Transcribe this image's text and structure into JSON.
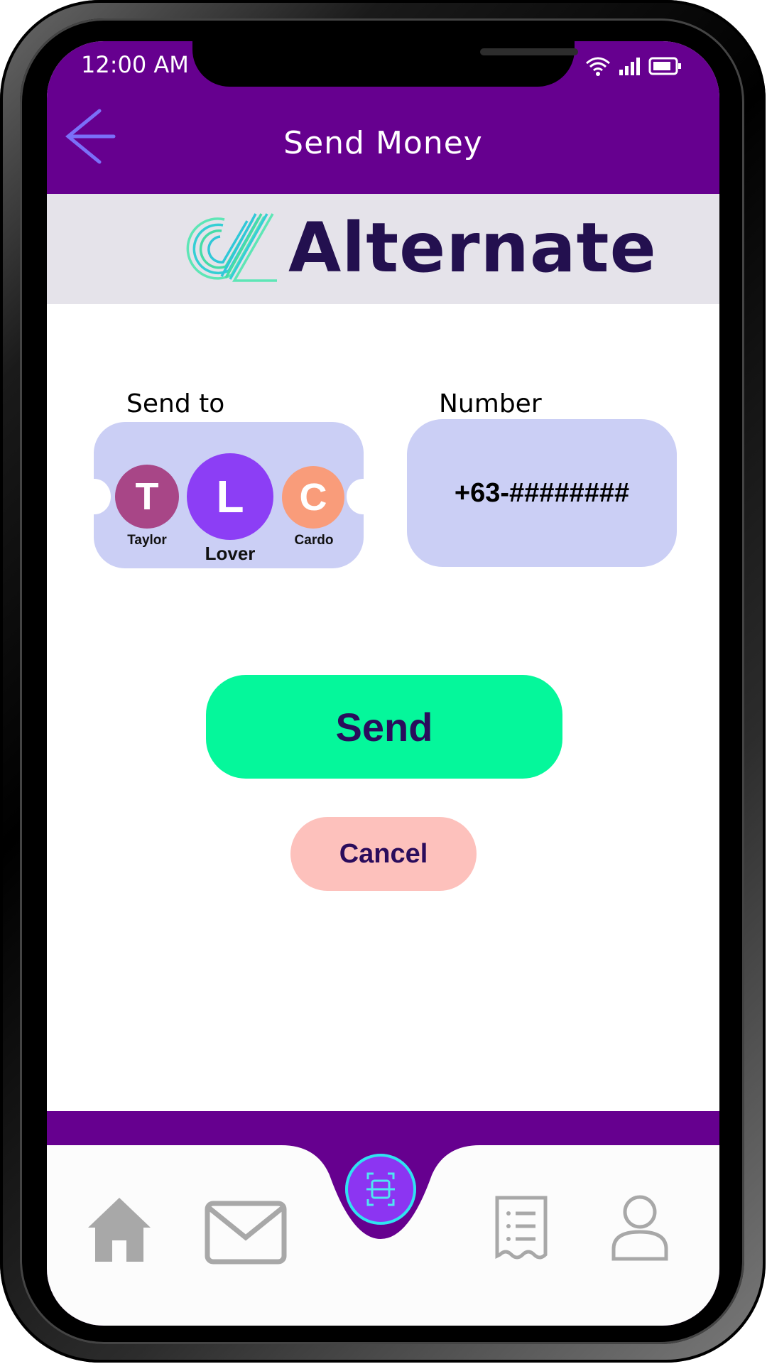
{
  "status_bar": {
    "time": "12:00 AM"
  },
  "header": {
    "title": "Send Money"
  },
  "brand": {
    "name": "Alternate"
  },
  "form": {
    "send_to_label": "Send to",
    "number_label": "Number",
    "number_value": "+63-########",
    "recipients": [
      {
        "initial": "T",
        "name": "Taylor",
        "color": "#a84687"
      },
      {
        "initial": "L",
        "name": "Lover",
        "color": "#8c3ef5"
      },
      {
        "initial": "C",
        "name": "Cardo",
        "color": "#f99c7a"
      }
    ]
  },
  "actions": {
    "send_label": "Send",
    "cancel_label": "Cancel"
  },
  "colors": {
    "header": "#66008f",
    "send": "#05f79b",
    "cancel": "#fdc1bc",
    "input": "#cbcff5",
    "nav_icon": "#a8a8a8"
  },
  "nav": [
    "home-icon",
    "mail-icon",
    "scan-icon",
    "receipt-icon",
    "profile-icon"
  ]
}
